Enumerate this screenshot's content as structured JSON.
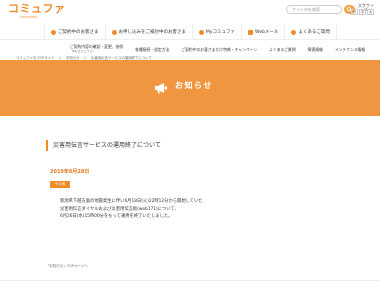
{
  "header": {
    "logo_main": "コミュファ",
    "logo_sub": "commufa",
    "search_placeholder": "サイト内を検索",
    "size_label": "文字サイズ",
    "size_buttons": [
      "小",
      "中",
      "大"
    ]
  },
  "mainnav": [
    {
      "label": "ご契約中のお客さま"
    },
    {
      "label": "お申し込みをご検討中のお客さま"
    },
    {
      "label": "Myコミュファ"
    },
    {
      "label": "Webメール"
    },
    {
      "label": "よくあるご質問"
    }
  ],
  "subnav": [
    {
      "label": "ご契約内容の確認・変更、参照",
      "sub": "（Myコミュファ）"
    },
    {
      "label": "各種接続・設定方法"
    },
    {
      "label": "ご契約中のお客さまだけ特典・キャンペーン"
    },
    {
      "label": "よくあるご質問"
    },
    {
      "label": "障害情報"
    },
    {
      "label": "メンテナンス情報"
    }
  ],
  "breadcrumb": [
    "コミュファ光 TOPサイト",
    "＞",
    "お知らせ",
    "＞",
    "災害用伝言サービスの運用終了について"
  ],
  "banner": {
    "title": "お知らせ"
  },
  "article": {
    "title": "災害用伝言サービスの運用終了について",
    "date": "2019年6月28日",
    "badge": "その他",
    "lines": [
      "新潟県下越方面の地震発生に伴い6月18日(火)22時12分から開始していた",
      "災害用伝言ダイヤルおよび災害用伝言板(web171)について、",
      "6月26日(水)15時00分をもって運用を終了いたしました。"
    ]
  },
  "footer": {
    "link": "「お知らせ」TOPページへ"
  },
  "colors": {
    "accent": "#f08c28",
    "banner": "#f19640"
  }
}
